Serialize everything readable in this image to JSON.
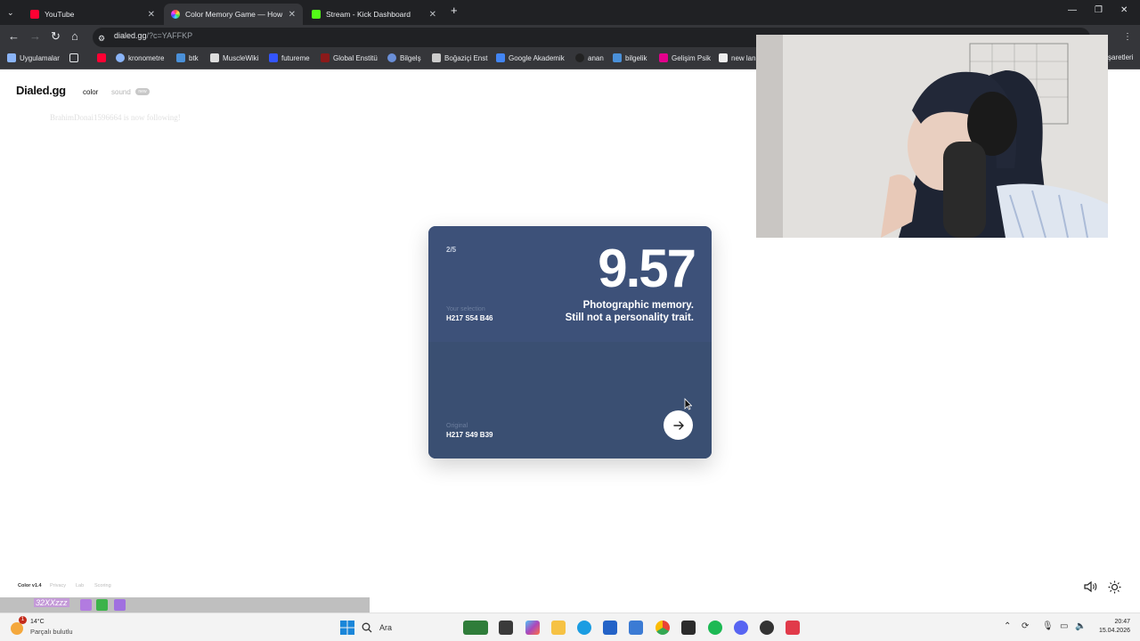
{
  "browser": {
    "tabs": [
      {
        "title": "YouTube",
        "icon": "youtube-icon",
        "color": "#ff0033",
        "active": false
      },
      {
        "title": "Color Memory Game — How W",
        "icon": "color-wheel-icon",
        "color": "#e85d75",
        "active": true
      },
      {
        "title": "Stream - Kick Dashboard",
        "icon": "kick-icon",
        "color": "#53fc18",
        "active": false
      }
    ],
    "new_tab_label": "+",
    "url_host": "dialed.gg",
    "url_path": "/?c=YAFFKP",
    "bookmarks": [
      {
        "label": "Uygulamalar",
        "icon": "apps-grid-icon",
        "color": "#8ab4f8"
      },
      {
        "label": "",
        "icon": "youtube-icon",
        "color": "#ff0033"
      },
      {
        "label": "kronometre",
        "icon": "clock-icon",
        "color": "#8ab4f8"
      },
      {
        "label": "btk",
        "icon": "btk-icon",
        "color": "#4a90d9"
      },
      {
        "label": "MuscleWiki",
        "icon": "musclewiki-icon",
        "color": "#dddddd"
      },
      {
        "label": "futureme",
        "icon": "futureme-icon",
        "color": "#3355ff"
      },
      {
        "label": "Global Enstitü",
        "icon": "global-enstitu-icon",
        "color": "#8b1a1a"
      },
      {
        "label": "Bilgelş",
        "icon": "bilgels-icon",
        "color": "#6a8fd8"
      },
      {
        "label": "Boğaziçi Enst",
        "icon": "bogazici-icon",
        "color": "#cccccc"
      },
      {
        "label": "Google Akademik",
        "icon": "google-scholar-icon",
        "color": "#4285f4"
      },
      {
        "label": "anan",
        "icon": "anan-icon",
        "color": "#222222"
      },
      {
        "label": "bilgelik",
        "icon": "bilgelik-icon",
        "color": "#4a90d9"
      },
      {
        "label": "Gelişim Psik",
        "icon": "gelisim-icon",
        "color": "#e3008c"
      },
      {
        "label": "new lan",
        "icon": "new-lan-icon",
        "color": "#eeeeee"
      }
    ],
    "bookmarks_right": "şaretleri"
  },
  "page": {
    "logo": "Dialed.gg",
    "nav_color": "color",
    "nav_sound": "sound",
    "nav_new_badge": "new",
    "follow_notice": "BrahimDonai1596664 is now following!",
    "card": {
      "round": "2/5",
      "score": "9.57",
      "message_line1": "Photographic memory.",
      "message_line2": "Still not a personality trait.",
      "selection_label": "Your selection",
      "selection_value": "H217 S54 B46",
      "original_label": "Original",
      "original_value": "H217 S49 B39",
      "selection_color": "#3d5179",
      "original_color": "#3a4f72"
    },
    "footer": {
      "version": "Color v1.4",
      "links": [
        "Privacy",
        "Lab",
        "Scoring"
      ]
    }
  },
  "overlay": {
    "chat_user": "32XXzzz"
  },
  "taskbar": {
    "weather_temp": "14°C",
    "weather_desc": "Parçalı bulutlu",
    "weather_badge": "1",
    "search_placeholder": "Ara",
    "time": "20:47",
    "date": "15.04.2026"
  }
}
